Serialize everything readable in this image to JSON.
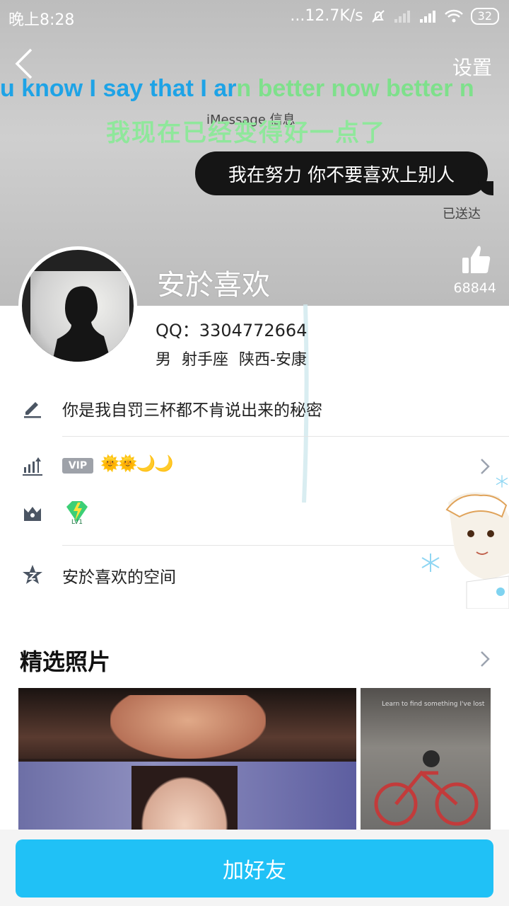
{
  "status_bar": {
    "time": "晚上8:28",
    "net_speed": "...12.7K/s",
    "battery": "32"
  },
  "header": {
    "settings_label": "设置",
    "lyric_en_sung": "u know I say that I ar",
    "lyric_en_unsung": "n better now better n",
    "lyric_cn": "我现在已经变得好一点了",
    "imessage_header": "iMessage 信息",
    "bubble_text": "我在努力 你不要喜欢上别人",
    "delivered": "已送达",
    "like_count": "68844"
  },
  "profile": {
    "nickname": "安於喜欢",
    "qq": "QQ：3304772664",
    "info": "男  射手座  陕西-安康"
  },
  "info_list": {
    "signature": "你是我自罚三杯都不肯说出来的秘密",
    "vip_label": "VIP",
    "level_icons": "🌞🌞🌙🌙",
    "gem_level": "LV1",
    "space": "安於喜欢的空间"
  },
  "photos": {
    "title": "精选照片",
    "side_caption": "Learn to find something I've lost"
  },
  "actions": {
    "add_friend": "加好友"
  },
  "colors": {
    "accent": "#20c1f6",
    "lyric_sung": "#1ea3e6",
    "lyric_unsung": "#7ee08b"
  }
}
